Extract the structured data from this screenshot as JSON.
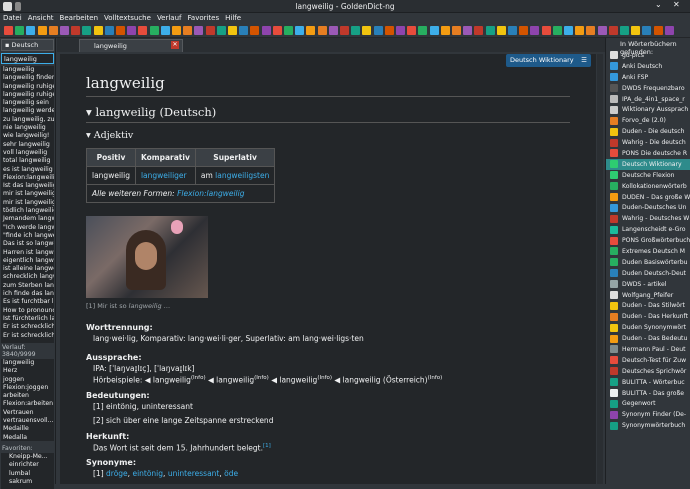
{
  "window": {
    "title": "langweilig - GoldenDict-ng"
  },
  "menu": [
    "Datei",
    "Ansicht",
    "Bearbeiten",
    "Volltextsuche",
    "Verlauf",
    "Favorites",
    "Hilfe"
  ],
  "left": {
    "group": "Deutsch",
    "search": "langweilig",
    "results": [
      "langweilig",
      "langweilig finden",
      "langweilig ruhige",
      "langweilig ruhige",
      "langweilig sein",
      "langweilig werde",
      "zu langweilig, zu",
      "nie langweilig",
      "wie langweilig!",
      "sehr langweilig",
      "voll langweilig",
      "total langweilig",
      "es ist langweilig",
      "Flexion:langweilig",
      "Ist das langweilig",
      "mir ist langweilig",
      "mir ist langweilig",
      "tödlich langweilig",
      "Jemandem langw",
      "\"Ich werde langw",
      "\"finde ich langwe",
      "Das ist so langwe",
      "Harren ist langwe",
      "eigentlich langw",
      "ist alleine langwe",
      "schrecklich langw",
      "zum Sterben lang",
      "ich finde das lang",
      "Es ist furchtbar la",
      "How to pronounc",
      "Ist fürchterlich la",
      "Er ist schrecklich",
      "Er ist schrecklich"
    ],
    "history_label": "Verlauf:",
    "history_count": "3840/9999",
    "history": [
      "langweilig",
      "Herz",
      "joggen",
      "Flexion:joggen",
      "arbeiten",
      "Flexion:arbeiten",
      "Vertrauen",
      "vertrauensvoll...",
      "Medaille",
      "Medalla"
    ],
    "favorites_label": "Favoriten:",
    "favorites": [
      "Kneipp-Me...",
      "einrichter",
      "lumbal",
      "sakrum"
    ]
  },
  "tab": {
    "label": "langweilig"
  },
  "dict_badge": "Deutsch Wiktionary",
  "article": {
    "headword": "langweilig",
    "h2": "langweilig (Deutsch)",
    "h3": "Adjektiv",
    "table": {
      "headers": [
        "Positiv",
        "Komparativ",
        "Superlativ"
      ],
      "row": [
        "langweilig",
        "langweiliger",
        "am",
        "langweiligsten"
      ],
      "more_prefix": "Alle weiteren Formen:",
      "more_link": "Flexion:langweilig"
    },
    "caption_prefix": "[1] Mir ist so ",
    "caption_em": "langweilig",
    "caption_suffix": " …",
    "wt_label": "Worttrennung:",
    "wt": "lang·wei·lig, Komparativ: lang·wei·li·ger, Superlativ: am lang·wei·ligs·ten",
    "aus_label": "Aussprache:",
    "ipa": "IPA: [ˈlaŋvaɪ̯lɪç], [ˈlaŋvaɪ̯lɪk]",
    "hb_label": "Hörbeispiele:",
    "hb": [
      "langweilig",
      "langweilig",
      "langweilig",
      "langweilig (Österreich)"
    ],
    "info": "(Info)",
    "bed_label": "Bedeutungen:",
    "bed": [
      "[1] eintönig, uninteressant",
      "[2] sich über eine lange Zeitspanne erstreckend"
    ],
    "her_label": "Herkunft:",
    "her": "Das Wort ist seit dem 15. Jahrhundert belegt.",
    "her_ref": "[1]",
    "syn_label": "Synonyme:",
    "syn_prefix": "[1]",
    "syn": [
      "dröge",
      "eintönig",
      "uninteressant",
      "öde"
    ]
  },
  "right": {
    "header": "In Wörterbüchern gefunden:",
    "items": [
      "gd-pics",
      "Anki Deutsch",
      "Anki FSP",
      "DWDS Frequenzbaro",
      "IPA_de_4in1_space_r",
      "Wiktionary Aussprach",
      "Forvo_de (2.0)",
      "Duden - Die deutsch",
      "Wahrig - Die deutsch",
      "PONS Die deutsche R",
      "Deutsch Wiktionary",
      "Deutsche Flexion",
      "Kollokationenwörterb",
      "DUDEN – Das große W",
      "Duden-Deutsches Un",
      "Wahrig - Deutsches W",
      "Langenscheidt e-Gro",
      "PONS Großwörterbuch",
      "Extremes Deutsch M",
      "Duden Basiswörterbu",
      "Duden Deutsch-Deut",
      "DWDS - artikel",
      "Wolfgang_Pfeifer",
      "Duden - Das Stilwört",
      "Duden - Das Herkunft",
      "Duden Synonymwört",
      "Duden - Das Bedeutu",
      "Hermann Paul - Deut",
      "Deutsch-Test für Zuw",
      "Deutsches Sprichwör",
      "BULITTA - Wörterbuc",
      "BULITTA - Das große",
      "Gegenwort",
      "Synonym Finder (De-",
      "Synonymwörterbuch"
    ],
    "selected_index": 10
  }
}
